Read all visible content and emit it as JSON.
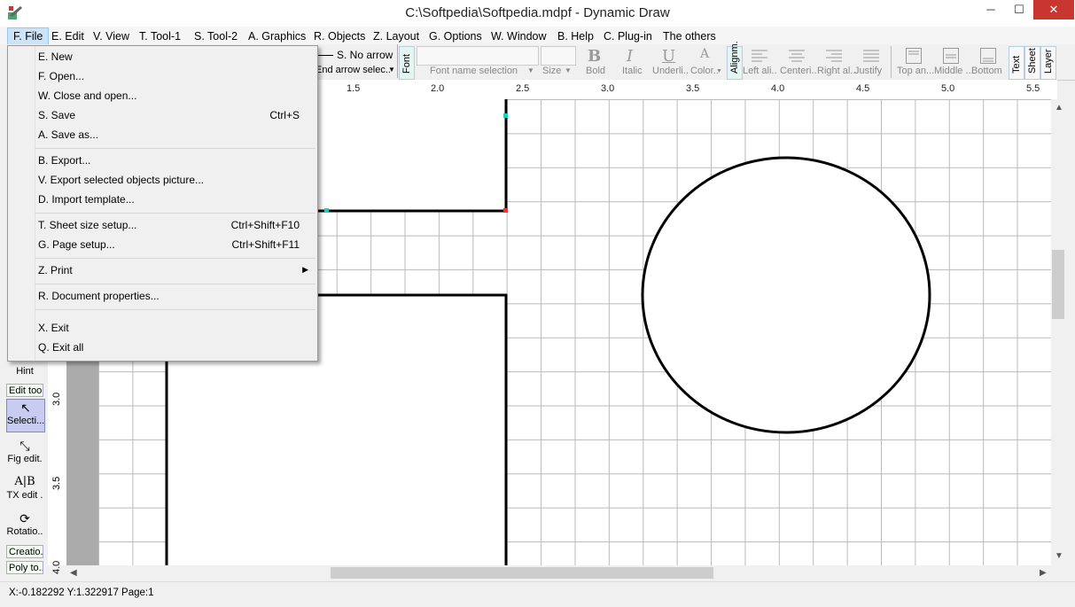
{
  "window": {
    "title": "C:\\Softpedia\\Softpedia.mdpf - Dynamic Draw",
    "minimize": "─",
    "maximize": "☐",
    "close": "✕"
  },
  "menubar": [
    "F. File",
    "E. Edit",
    "V. View",
    "T. Tool-1",
    "S. Tool-2",
    "A. Graphics",
    "R. Objects",
    "Z. Layout",
    "G. Options",
    "W. Window",
    "B. Help",
    "C. Plug-in",
    "The others"
  ],
  "toolbar": {
    "arrow_end": "S. No arrow",
    "arrow_sel": "End arrow selec..",
    "font_tab": "Font",
    "font_name": "Font name selection",
    "size": "Size",
    "bold": "Bold",
    "italic": "Italic",
    "underline": "Underli..",
    "color": "Color..",
    "align_tab": "Alignm.",
    "left_align": "Left ali..",
    "center": "Centeri..",
    "right_align": "Right al..",
    "justify": "Justify",
    "top": "Top an...",
    "middle": "Middle ...",
    "bottom": "Bottom",
    "text_tab": "Text",
    "sheet_tab": "Sheet",
    "layer_tab": "Layer"
  },
  "ruler_top": [
    "1.5",
    "2.0",
    "2.5",
    "3.0",
    "3.5",
    "4.0",
    "4.5",
    "5.0",
    "5.5"
  ],
  "ruler_left": [
    "3.0",
    "3.5",
    "4.0"
  ],
  "leftpanel": {
    "hint": "Hint",
    "edit_tools": "Edit too.",
    "selection": "Selecti...",
    "fig_edit": "Fig edit.",
    "tx_edit": "TX edit .",
    "rotation": "Rotatio..",
    "creation": "Creatio..",
    "poly": "Poly to.."
  },
  "file_menu": {
    "new": "E. New",
    "open": "F. Open...",
    "close_open": "W. Close and open...",
    "save": "S. Save",
    "save_sc": "Ctrl+S",
    "save_as": "A. Save as...",
    "export": "B. Export...",
    "export_sel": "V. Export selected objects picture...",
    "import_tpl": "D. Import template...",
    "sheet_size": "T. Sheet size setup...",
    "sheet_size_sc": "Ctrl+Shift+F10",
    "page_setup": "G. Page setup...",
    "page_setup_sc": "Ctrl+Shift+F11",
    "print": "Z. Print",
    "doc_props": "R. Document properties...",
    "exit": "X. Exit",
    "exit_all": "Q. Exit all"
  },
  "status": "X:-0.182292 Y:1.322917 Page:1"
}
